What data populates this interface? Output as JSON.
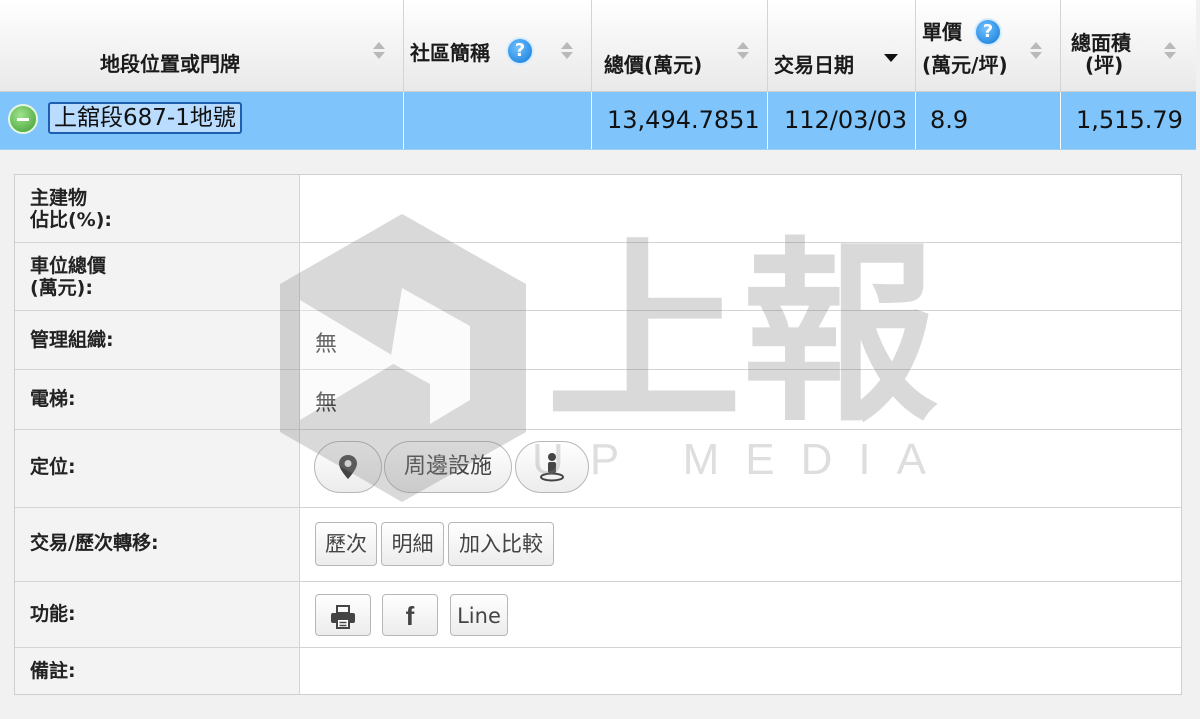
{
  "header": {
    "col_location": "地段位置或門牌",
    "col_community": "社區簡稱",
    "col_total_price": "總價(萬元)",
    "col_date": "交易日期",
    "col_unit_price_line1": "單價",
    "col_unit_price_line2": "(萬元/坪)",
    "col_area_line1": "總面積",
    "col_area_line2": "(坪)",
    "help_glyph": "?"
  },
  "row": {
    "location": "上舘段687-1地號",
    "community": "",
    "total_price": "13,494.7851",
    "date": "112/03/03",
    "unit_price": "8.9",
    "area": "1,515.79"
  },
  "detail": {
    "main_building_label_line1": "主建物",
    "main_building_label_line2": "佔比(%):",
    "main_building_value": "",
    "parking_label_line1": "車位總價",
    "parking_label_line2": "(萬元):",
    "parking_value": "",
    "management_label": "管理組織:",
    "management_value": "無",
    "elevator_label": "電梯:",
    "elevator_value": "無",
    "location_label": "定位:",
    "nearby_button": "周邊設施",
    "transfer_label": "交易/歷次轉移:",
    "history_button": "歷次",
    "details_button": "明細",
    "compare_button": "加入比較",
    "function_label": "功能:",
    "line_button": "Line",
    "facebook_glyph": "f",
    "remarks_label": "備註:",
    "remarks_value": ""
  },
  "watermark": {
    "title": "上報",
    "subtitle": "UP MEDIA"
  },
  "icons": {
    "map_pin": "map-pin-icon",
    "street_view": "street-view-icon",
    "print": "printer-icon",
    "facebook": "facebook-icon",
    "collapse": "collapse-minus-icon",
    "help": "help-icon"
  },
  "colors": {
    "selected_row": "#7fc4fb",
    "help_icon": "#1179d6",
    "collapse_icon": "#3f9d2f"
  }
}
